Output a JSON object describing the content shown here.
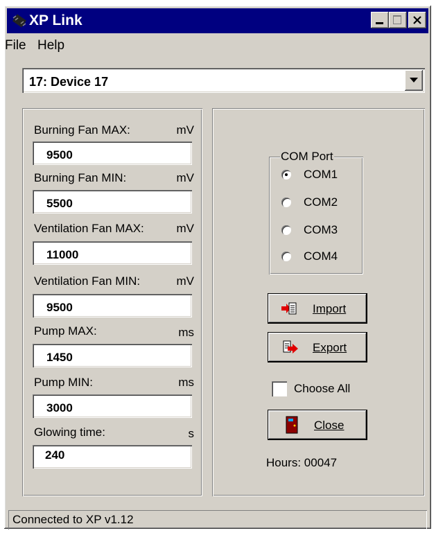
{
  "window": {
    "title": "XP Link"
  },
  "menu": {
    "items": [
      "File",
      "Help"
    ]
  },
  "device_select": {
    "value": "17: Device 17"
  },
  "params": [
    {
      "label": "Burning Fan MAX:",
      "unit": "mV",
      "value": "9500"
    },
    {
      "label": "Burning Fan MIN:",
      "unit": "mV",
      "value": "5500"
    },
    {
      "label": "Ventilation Fan MAX:",
      "unit": "mV",
      "value": "11000"
    },
    {
      "label": "Ventilation Fan MIN:",
      "unit": "mV",
      "value": "9500"
    },
    {
      "label": "Pump MAX:",
      "unit": "ms",
      "value": "1450"
    },
    {
      "label": "Pump MIN:",
      "unit": "ms",
      "value": "3000"
    },
    {
      "label": "Glowing time:",
      "unit": "s",
      "value": "240"
    }
  ],
  "com_port": {
    "title": "COM Port",
    "options": [
      "COM1",
      "COM2",
      "COM3",
      "COM4"
    ],
    "selected": "COM1"
  },
  "buttons": {
    "import": "Import",
    "export": "Export",
    "close": "Close"
  },
  "choose_all": {
    "label": "Choose All",
    "checked": false
  },
  "hours": "Hours: 00047",
  "status": "Connected to XP v1.12"
}
